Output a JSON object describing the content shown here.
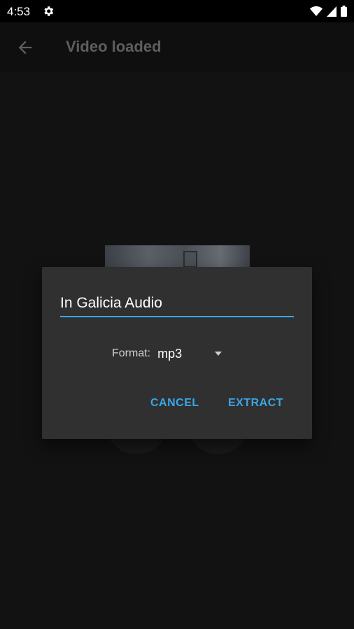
{
  "status_bar": {
    "time": "4:53"
  },
  "app_bar": {
    "title": "Video loaded"
  },
  "dialog": {
    "name_value": "In Galicia Audio",
    "format_label": "Format:",
    "format_value": "mp3",
    "cancel_label": "CANCEL",
    "extract_label": "EXTRACT"
  },
  "colors": {
    "accent": "#3aa6e8",
    "dialog_bg": "#303030",
    "screen_bg": "#121212"
  }
}
